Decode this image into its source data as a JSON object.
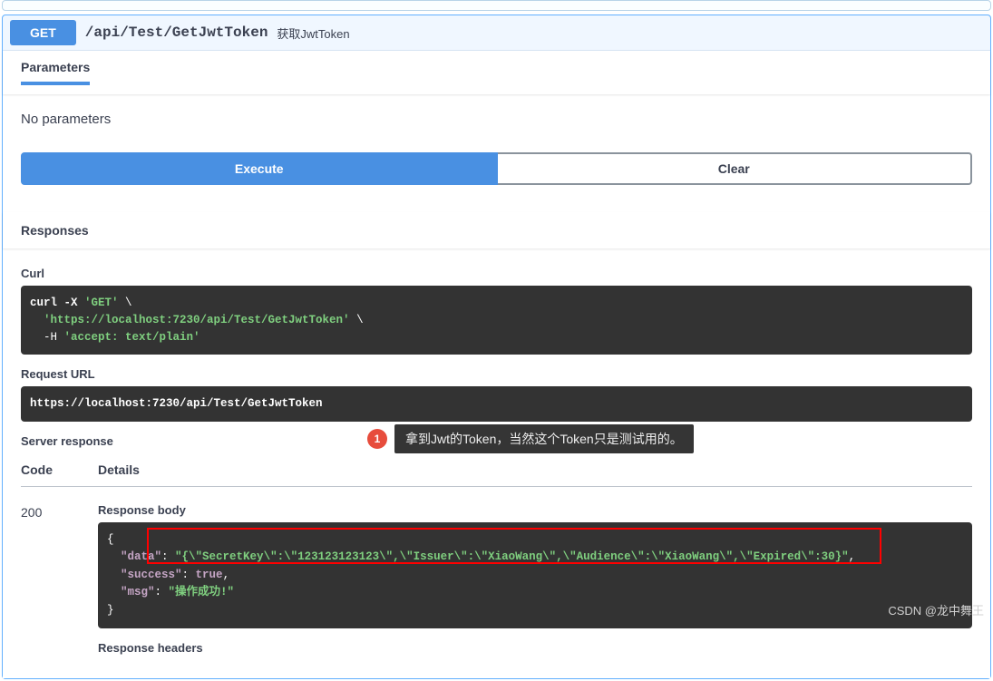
{
  "method": "GET",
  "path": "/api/Test/GetJwtToken",
  "summary": "获取JwtToken",
  "tabs": {
    "parameters": "Parameters"
  },
  "no_params": "No parameters",
  "buttons": {
    "execute": "Execute",
    "clear": "Clear"
  },
  "responses_label": "Responses",
  "curl": {
    "label": "Curl",
    "line1_cmd": "curl -X ",
    "line1_method": "'GET'",
    "line1_end": " \\",
    "line2": "  'https://localhost:7230/api/Test/GetJwtToken'",
    "line2_end": " \\",
    "line3_flag": "  -H ",
    "line3_val": "'accept: text/plain'"
  },
  "request_url": {
    "label": "Request URL",
    "value": "https://localhost:7230/api/Test/GetJwtToken"
  },
  "server_response_label": "Server response",
  "table": {
    "code": "Code",
    "details": "Details"
  },
  "response": {
    "code": "200",
    "body_label": "Response body",
    "json": {
      "open": "{",
      "key_data": "\"data\"",
      "val_data": "\"{\\\"SecretKey\\\":\\\"123123123123\\\",\\\"Issuer\\\":\\\"XiaoWang\\\",\\\"Audience\\\":\\\"XiaoWang\\\",\\\"Expired\\\":30}\"",
      "key_success": "\"success\"",
      "val_success": "true",
      "key_msg": "\"msg\"",
      "val_msg": "\"操作成功!\"",
      "close": "}"
    },
    "headers_label": "Response headers"
  },
  "annotation": {
    "num": "1",
    "text": "拿到Jwt的Token，当然这个Token只是测试用的。"
  },
  "watermark": "CSDN @龙中舞王"
}
